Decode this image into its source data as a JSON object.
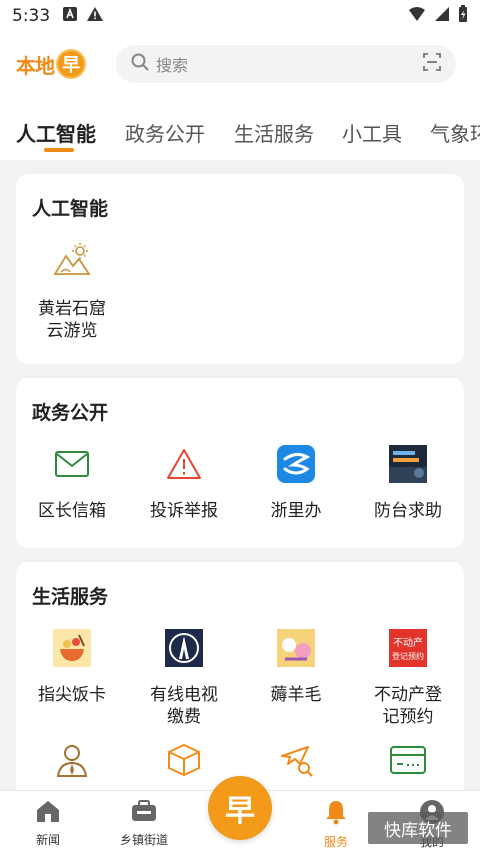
{
  "status": {
    "time": "5:33"
  },
  "header": {
    "logo_text": "本地",
    "logo_badge": "早",
    "search_placeholder": "搜索"
  },
  "tabs": [
    "人工智能",
    "政务公开",
    "生活服务",
    "小工具",
    "气象环"
  ],
  "sections": {
    "ai": {
      "title": "人工智能",
      "items": [
        {
          "line1": "黄岩石窟",
          "line2": "云游览",
          "icon": "mountain-sun-icon"
        }
      ]
    },
    "gov": {
      "title": "政务公开",
      "items": [
        {
          "label": "区长信箱",
          "icon": "mail-icon"
        },
        {
          "label": "投诉举报",
          "icon": "warning-icon"
        },
        {
          "label": "浙里办",
          "icon": "zheliban-app-icon"
        },
        {
          "label": "防台求助",
          "icon": "typhoon-help-icon"
        }
      ]
    },
    "life": {
      "title": "生活服务",
      "items": [
        {
          "label": "指尖饭卡",
          "icon": "food-card-icon"
        },
        {
          "line1": "有线电视",
          "line2": "缴费",
          "icon": "cable-tv-icon"
        },
        {
          "label": "薅羊毛",
          "icon": "coupon-icon"
        },
        {
          "line1": "不动产登",
          "line2": "记预约",
          "icon": "real-estate-icon",
          "badge_line1": "不动产",
          "badge_line2": "登记预约"
        }
      ]
    }
  },
  "bottom_nav": {
    "news": "新闻",
    "street": "乡镇街道",
    "center": "早",
    "service": "服务",
    "mine": "我的"
  },
  "watermark": "快库软件",
  "colors": {
    "accent": "#f08a18",
    "green": "#2e8b3e",
    "red": "#e5462f",
    "gold": "#c9953f"
  }
}
